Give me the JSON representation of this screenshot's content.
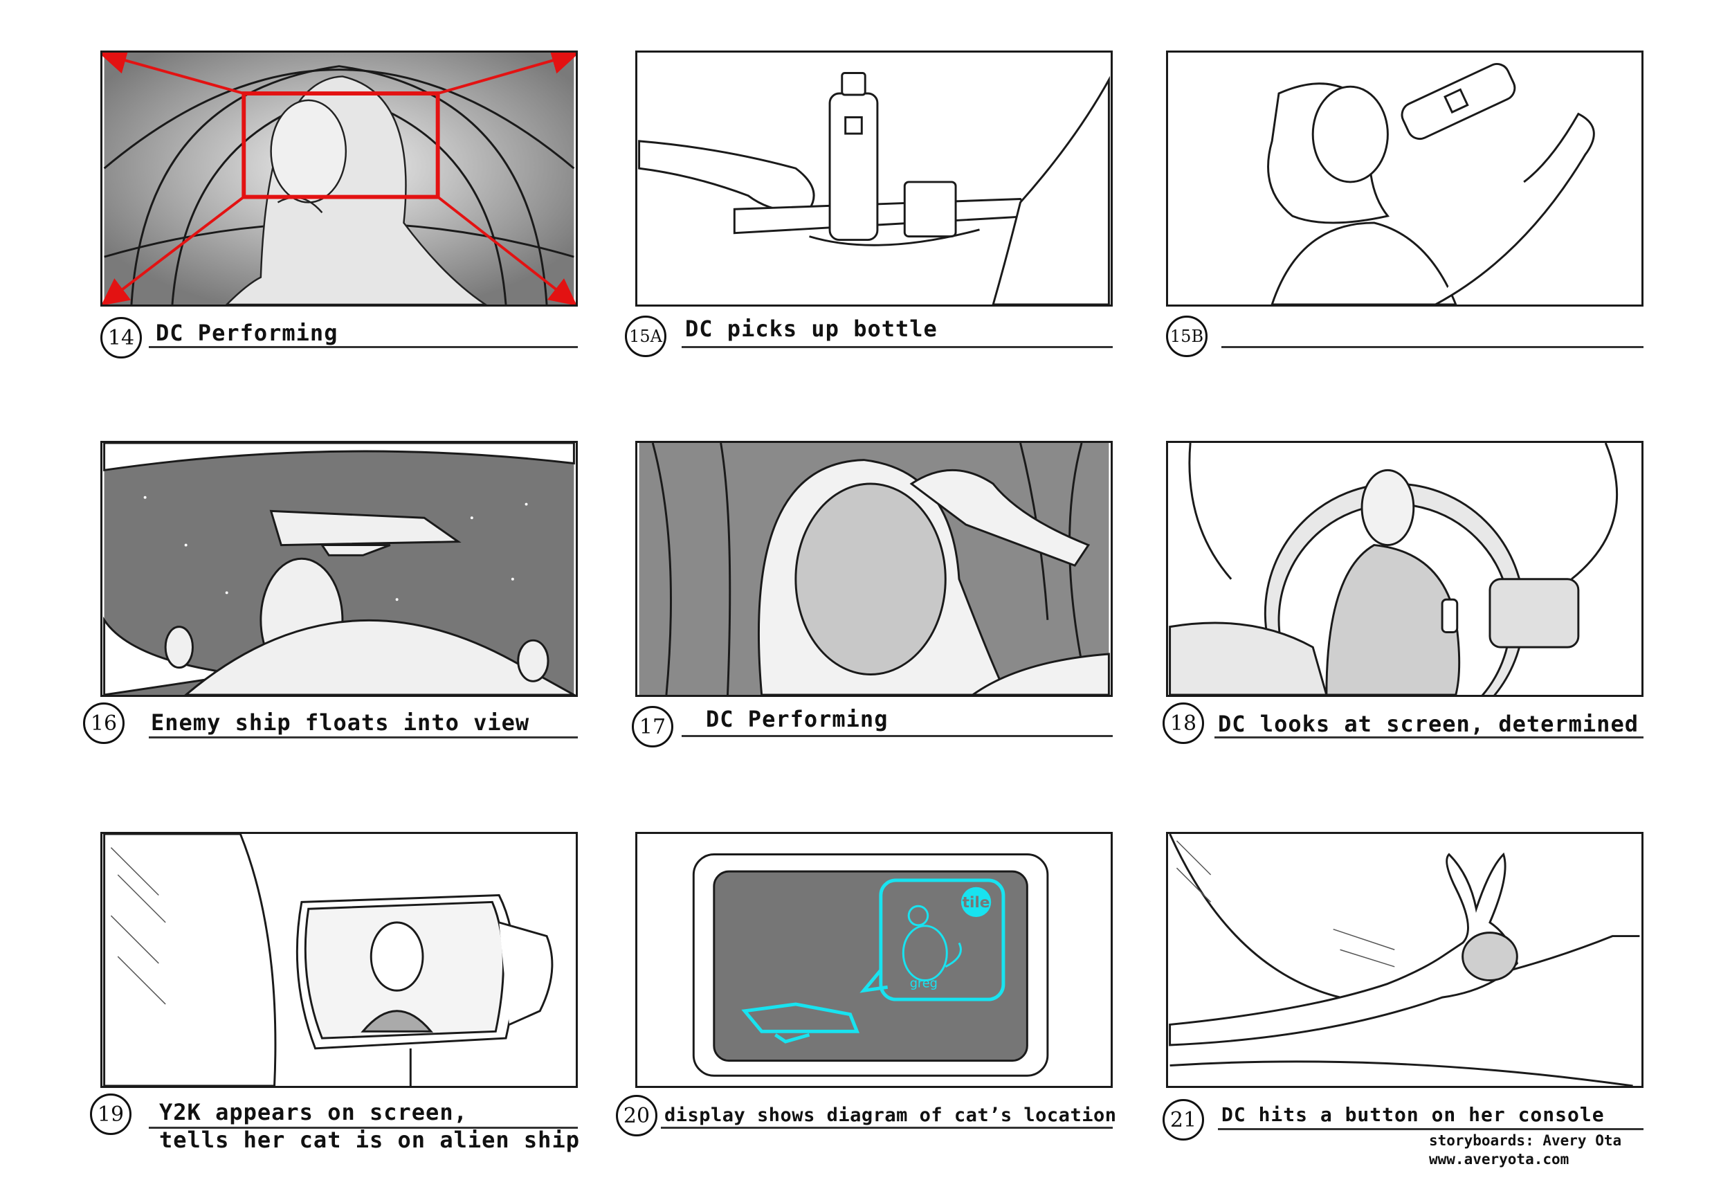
{
  "panels": [
    {
      "number": "14",
      "caption": ""
    },
    {
      "number": "15A",
      "caption": ""
    },
    {
      "number": "15B",
      "caption": ""
    },
    {
      "number": "16",
      "caption": ""
    },
    {
      "number": "17",
      "caption": ""
    },
    {
      "number": "18",
      "caption": ""
    },
    {
      "number": "19",
      "caption": "",
      "caption_line2": ""
    },
    {
      "number": "20",
      "caption": ""
    },
    {
      "number": "21",
      "caption": ""
    }
  ],
  "credits": {
    "line1": "storyboards: Avery Ota",
    "line2": "www.averyota.com"
  },
  "panel20_screen": {
    "badge": "tile",
    "cat_name": "greg"
  },
  "colors": {
    "red_marks": "#e31212",
    "cyan_ui": "#18e3f0",
    "ink": "#1a1a1a"
  }
}
